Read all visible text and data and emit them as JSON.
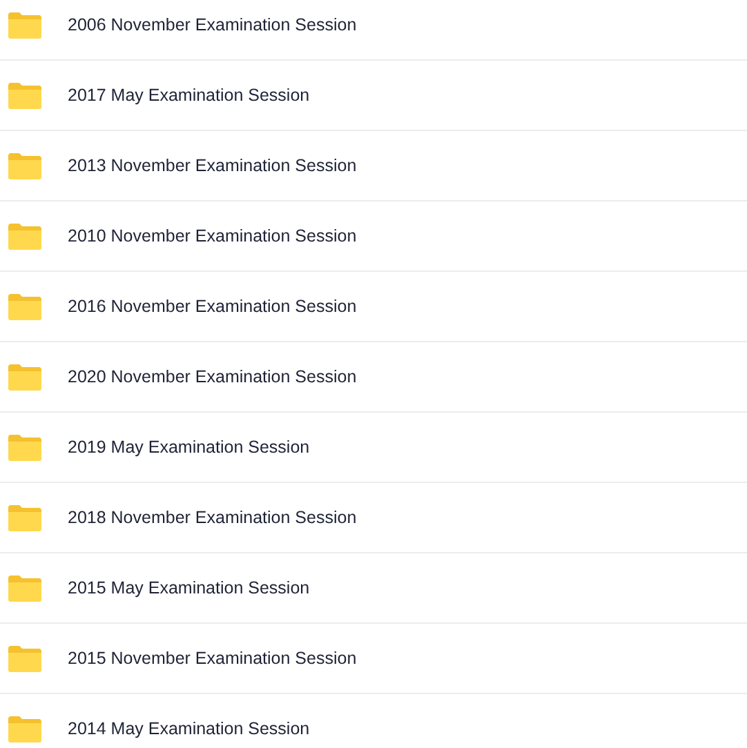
{
  "folders": [
    {
      "name": "2006 November Examination Session"
    },
    {
      "name": "2017 May Examination Session"
    },
    {
      "name": "2013 November Examination Session"
    },
    {
      "name": "2010 November Examination Session"
    },
    {
      "name": "2016 November Examination Session"
    },
    {
      "name": "2020 November Examination Session"
    },
    {
      "name": "2019 May Examination Session"
    },
    {
      "name": "2018 November Examination Session"
    },
    {
      "name": "2015 May Examination Session"
    },
    {
      "name": "2015 November Examination Session"
    },
    {
      "name": "2014 May Examination Session"
    }
  ]
}
